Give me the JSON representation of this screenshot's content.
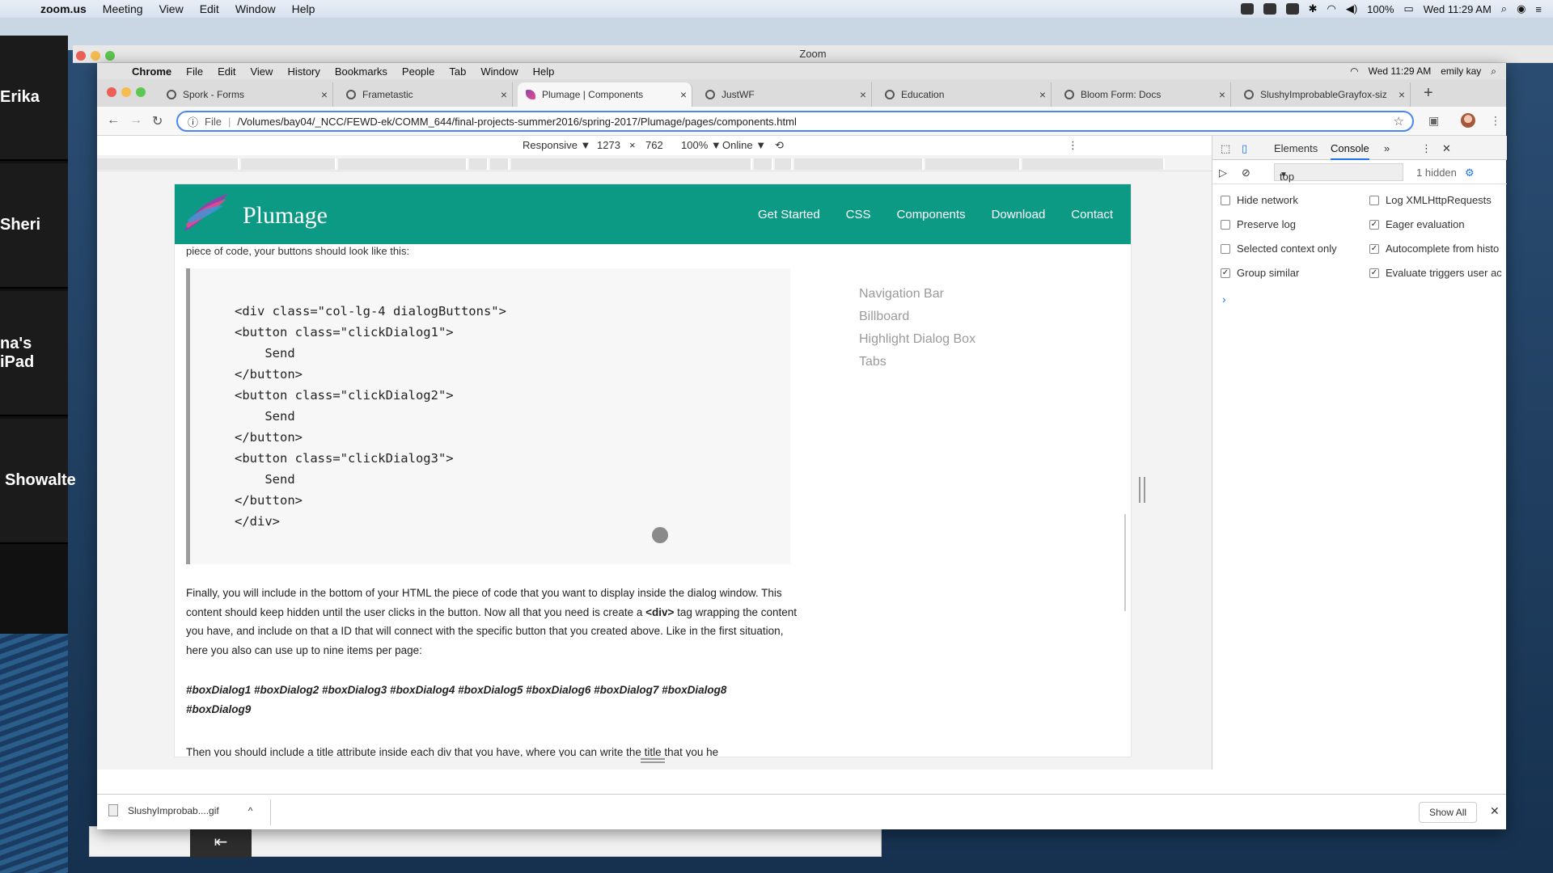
{
  "mac_menubar": {
    "app": "zoom.us",
    "items": [
      "Meeting",
      "View",
      "Edit",
      "Window",
      "Help"
    ],
    "battery": "100%",
    "clock": "Wed 11:29 AM"
  },
  "zoom": {
    "window_title": "Zoom",
    "participants": [
      "Erika",
      "Sheri",
      "na's iPad",
      "Showalte"
    ]
  },
  "chrome_menubar": {
    "app": "Chrome",
    "items": [
      "File",
      "Edit",
      "View",
      "History",
      "Bookmarks",
      "People",
      "Tab",
      "Window",
      "Help"
    ],
    "clock": "Wed 11:29 AM",
    "user": "emily kay"
  },
  "tabs": [
    {
      "label": "Spork - Forms"
    },
    {
      "label": "Frametastic"
    },
    {
      "label": "Plumage | Components"
    },
    {
      "label": "JustWF"
    },
    {
      "label": "Education"
    },
    {
      "label": "Bloom Form: Docs"
    },
    {
      "label": "SlushyImprobableGrayfox-size"
    }
  ],
  "address": {
    "scheme": "File",
    "url": "/Volumes/bay04/_NCC/FEWD-ek/COMM_644/final-projects-summer2016/spring-2017/Plumage/pages/components.html"
  },
  "device_toolbar": {
    "mode": "Responsive ▼",
    "width": "1273",
    "times": "×",
    "height": "762",
    "zoom": "100% ▼",
    "network": "Online ▼"
  },
  "site": {
    "brand": "Plumage",
    "nav": [
      "Get Started",
      "CSS",
      "Components",
      "Download",
      "Contact"
    ],
    "intro": "piece of code, your buttons should look like this:",
    "code": "<div class=\"col-lg-4 dialogButtons\">\n<button class=\"clickDialog1\">\n    Send\n</button>\n<button class=\"clickDialog2\">\n    Send\n</button>\n<button class=\"clickDialog3\">\n    Send\n</button>\n</div>",
    "side_links": [
      "Navigation Bar",
      "Billboard",
      "Highlight Dialog Box",
      "Tabs"
    ],
    "para_before": "Finally, you will include in the bottom of your HTML the piece of code that you want to display inside the dialog window. This content should keep hidden until the user clicks in the button. Now all that you need is create a ",
    "para_tag": "<div>",
    "para_after": " tag wrapping the content you have, and include on that a ID that will connect with the specific button that you created above. Like in the first situation, here you also can use up to nine items per page:",
    "box_ids": "#boxDialog1 #boxDialog2 #boxDialog3 #boxDialog4 #boxDialog5 #boxDialog6 #boxDialog7 #boxDialog8 #boxDialog9",
    "cut_line": "Then you should include a title attribute inside each div that you have, where you can write the title that you he"
  },
  "devtools": {
    "tabs": [
      "Elements",
      "Console",
      "»"
    ],
    "context": "top",
    "hidden": "1 hidden",
    "options": [
      {
        "label": "Hide network",
        "checked": false
      },
      {
        "label": "Log XMLHttpRequests",
        "checked": false
      },
      {
        "label": "Preserve log",
        "checked": false
      },
      {
        "label": "Eager evaluation",
        "checked": true
      },
      {
        "label": "Selected context only",
        "checked": false
      },
      {
        "label": "Autocomplete from histo",
        "checked": true
      },
      {
        "label": "Group similar",
        "checked": true
      },
      {
        "label": "Evaluate triggers user ac",
        "checked": true
      }
    ],
    "prompt": "›"
  },
  "download": {
    "file": "SlushyImprobab....gif",
    "show_all": "Show All"
  },
  "colors": {
    "nav_teal": "#0c9a84",
    "devtools_accent": "#1a73e8"
  }
}
